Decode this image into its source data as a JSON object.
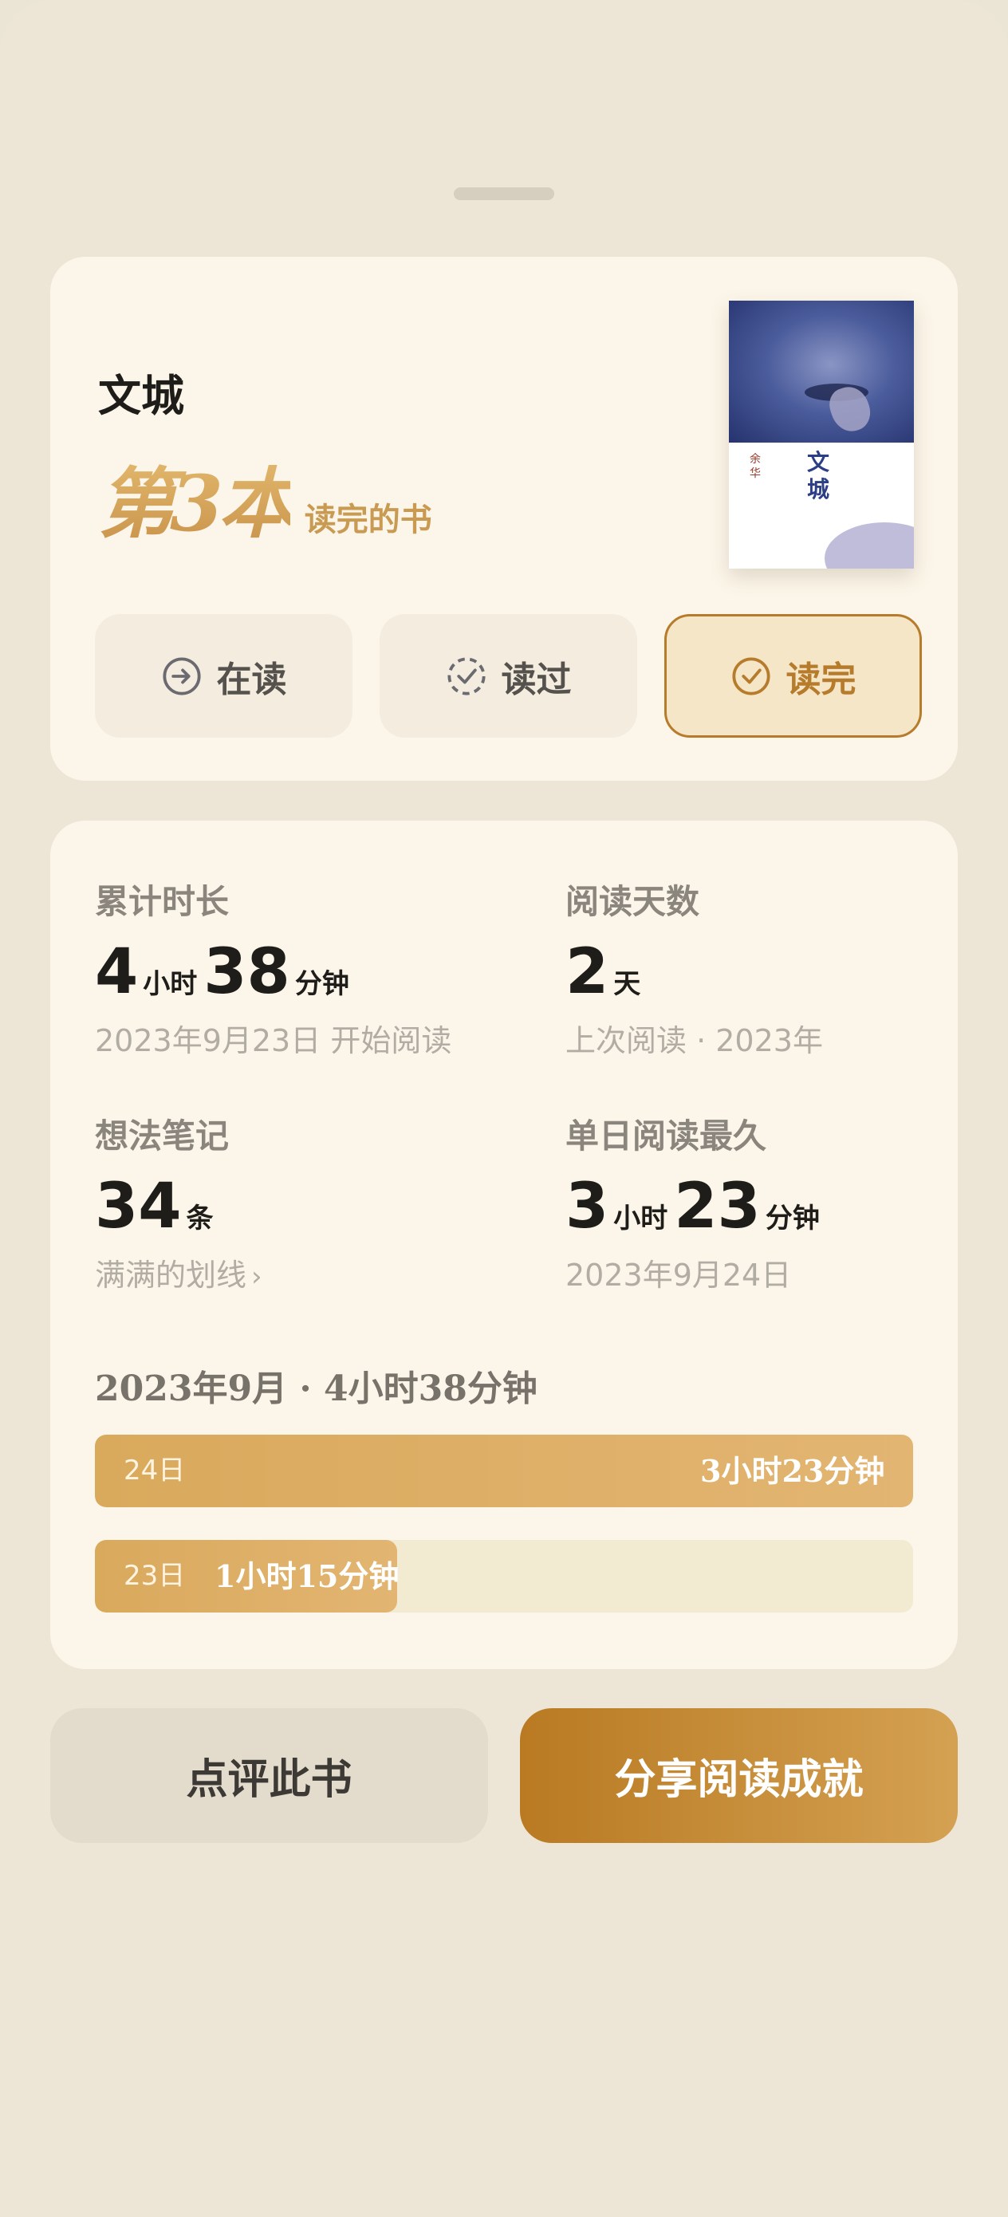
{
  "book": {
    "title": "文城",
    "rank_big": "第3本",
    "rank_small": "读完的书",
    "cover": {
      "title": "文城",
      "author": "余华"
    }
  },
  "status_buttons": [
    {
      "label": "在读",
      "icon": "arrow-circle-icon",
      "active": false
    },
    {
      "label": "读过",
      "icon": "dashed-check-circle-icon",
      "active": false
    },
    {
      "label": "读完",
      "icon": "check-circle-icon",
      "active": true
    }
  ],
  "stats": {
    "total_time": {
      "label": "累计时长",
      "hours": "4",
      "hours_unit": "小时",
      "minutes": "38",
      "minutes_unit": "分钟",
      "sub": "2023年9月23日 开始阅读"
    },
    "reading_days": {
      "label": "阅读天数",
      "value": "2",
      "unit": "天",
      "sub": "上次阅读 · 2023年"
    },
    "notes": {
      "label": "想法笔记",
      "value": "34",
      "unit": "条",
      "sub": "满满的划线",
      "chevron": "›"
    },
    "longest_day": {
      "label": "单日阅读最久",
      "hours": "3",
      "hours_unit": "小时",
      "minutes": "23",
      "minutes_unit": "分钟",
      "sub": "2023年9月24日"
    }
  },
  "month_summary": "2023年9月 · 4小时38分钟",
  "daily_bars": [
    {
      "date": "24日",
      "duration": "3小时23分钟",
      "minutes": 203
    },
    {
      "date": "23日",
      "duration": "1小时15分钟",
      "minutes": 75
    }
  ],
  "actions": {
    "review": "点评此书",
    "share": "分享阅读成就"
  },
  "colors": {
    "background": "#ebe5d5",
    "card": "#fcf6ea",
    "accent": "#b67b2b",
    "bar": "#d9a95c"
  }
}
